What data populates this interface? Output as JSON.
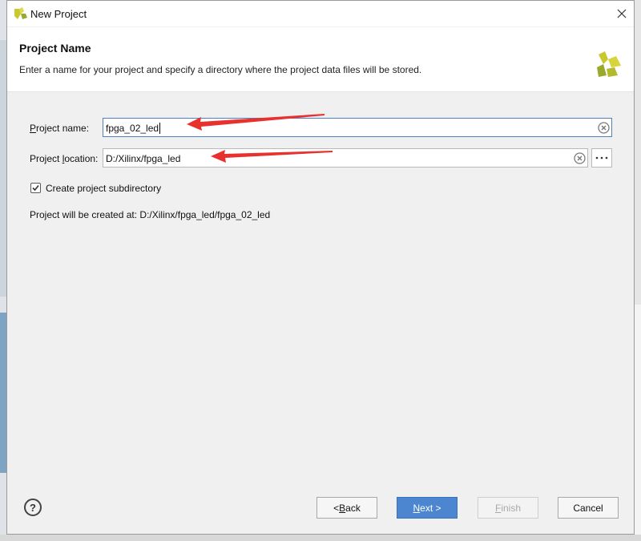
{
  "window": {
    "title": "New Project",
    "icon": "vivado-logo-icon"
  },
  "header": {
    "title": "Project Name",
    "description": "Enter a name for your project and specify a directory where the project data files will be stored."
  },
  "form": {
    "project_name": {
      "label_pre": "",
      "label_mnemonic": "P",
      "label_post": "roject name:",
      "value": "fpga_02_led"
    },
    "project_location": {
      "label_pre": "Project ",
      "label_mnemonic": "l",
      "label_post": "ocation:",
      "value": "D:/Xilinx/fpga_led"
    },
    "subdirectory": {
      "label": "Create project subdirectory",
      "checked": true
    },
    "created_at": "Project will be created at: D:/Xilinx/fpga_led/fpga_02_led"
  },
  "footer": {
    "help": "?",
    "back": {
      "pre": "< ",
      "mnemonic": "B",
      "post": "ack"
    },
    "next": {
      "pre": "",
      "mnemonic": "N",
      "post": "ext >"
    },
    "finish": {
      "pre": "",
      "mnemonic": "F",
      "post": "inish"
    },
    "cancel": "Cancel"
  },
  "colors": {
    "accent": "#4c86d0",
    "annotation_arrow": "#e8312f",
    "logo_yellow": "#c9c92e",
    "logo_green": "#9aa82b"
  }
}
